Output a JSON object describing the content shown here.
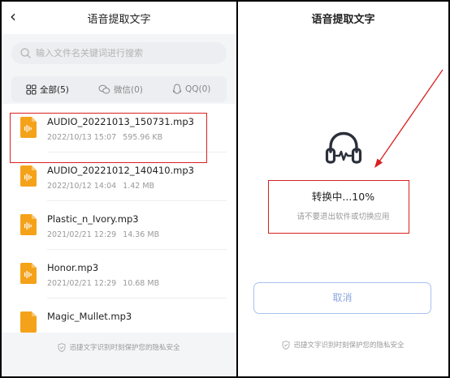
{
  "left": {
    "title": "语音提取文字",
    "back_glyph": "‹",
    "search": {
      "placeholder": "输入文件名关键词进行搜索"
    },
    "tabs": [
      {
        "label": "全部(5)",
        "icon": "grid-icon",
        "active": true
      },
      {
        "label": "微信(0)",
        "icon": "wechat-icon",
        "active": false
      },
      {
        "label": "QQ(0)",
        "icon": "qq-icon",
        "active": false
      }
    ],
    "files": [
      {
        "name": "AUDIO_20221013_150731.mp3",
        "date": "2022/10/13 15:07",
        "size": "595.96 KB"
      },
      {
        "name": "AUDIO_20221012_140410.mp3",
        "date": "2022/10/12 14:04",
        "size": "1.42 MB"
      },
      {
        "name": "Plastic_n_Ivory.mp3",
        "date": "2021/02/21 12:29",
        "size": "14.36 MB"
      },
      {
        "name": "Honor.mp3",
        "date": "2021/02/21 12:29",
        "size": "10.68 MB"
      },
      {
        "name": "Magic_Mullet.mp3",
        "date": "",
        "size": ""
      }
    ],
    "privacy": "迅捷文字识别时刻保护您的隐私安全"
  },
  "right": {
    "title": "语音提取文字",
    "status": "转换中...10%",
    "progress_percent": 10,
    "hint": "请不要退出软件或切换应用",
    "cancel_label": "取消",
    "privacy": "迅捷文字识别时刻保护您的隐私安全"
  },
  "colors": {
    "file_icon": "#f5a21b",
    "highlight": "#d92020",
    "cancel_border": "#a9c2f0",
    "cancel_text": "#8ba6dc"
  }
}
